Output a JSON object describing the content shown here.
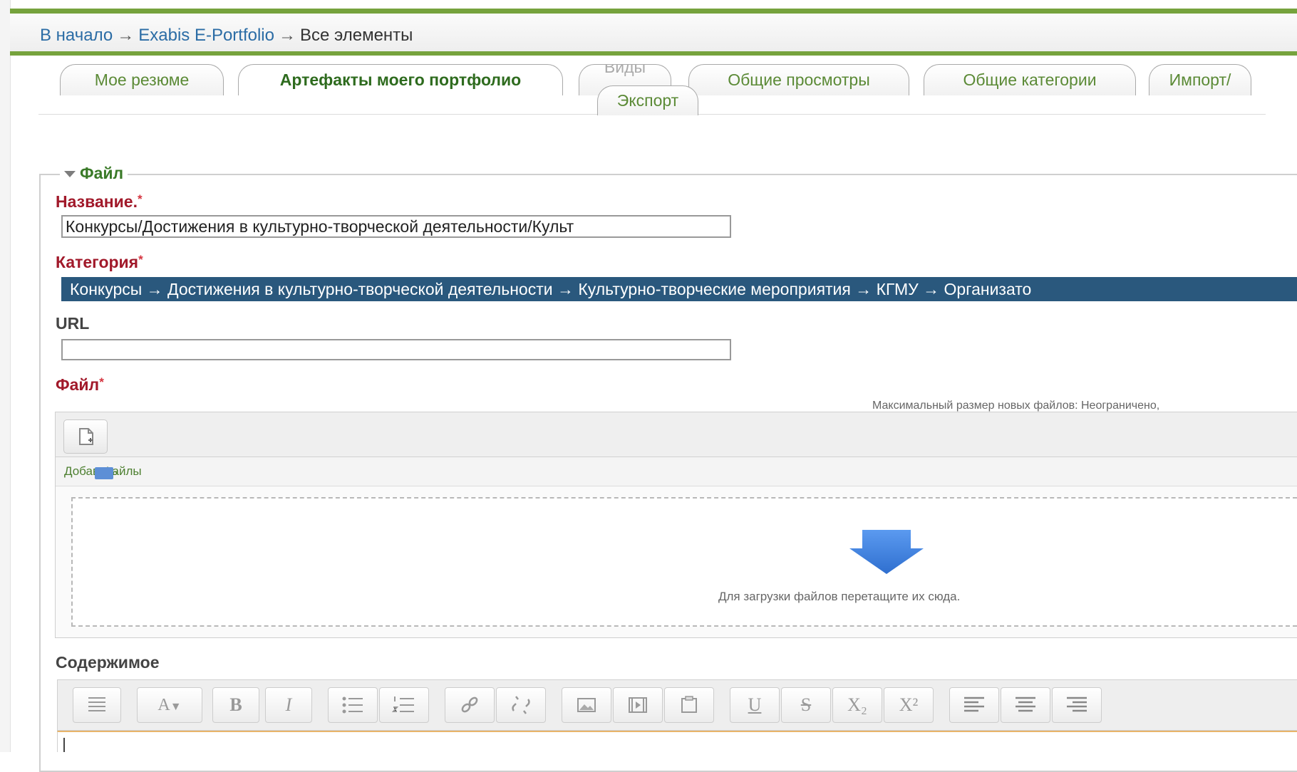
{
  "breadcrumb": {
    "home": "В начало",
    "separator": "→",
    "portfolio": "Exabis E-Portfolio",
    "current": "Все элементы"
  },
  "tabs": [
    {
      "label": "Мое резюме",
      "active": false
    },
    {
      "label": "Артефакты моего портфолио",
      "active": true
    },
    {
      "label": "Виды",
      "active": false
    },
    {
      "label": "Экспорт",
      "active": false
    },
    {
      "label": "Общие просмотры",
      "active": false
    },
    {
      "label": "Общие категории",
      "active": false
    },
    {
      "label": "Импорт/",
      "active": false
    }
  ],
  "form": {
    "legend": "Файл",
    "required_mark": "*",
    "title_label": "Название.",
    "title_value": "Конкурсы/Достижения в культурно-творческой деятельности/Культ",
    "category_label": "Категория",
    "category_value": "Конкурсы → Достижения в культурно-творческой деятельности → Культурно-творческие мероприятия → КГМУ → Организато",
    "url_label": "URL",
    "url_value": "",
    "file_label": "Файл",
    "max_size_text": "Максимальный размер новых файлов: Неограничено,",
    "path_text": "Добавить",
    "folder_text": "Файлы",
    "drop_text": "Для загрузки файлов перетащите их сюда.",
    "content_label": "Содержимое"
  },
  "editor_toolbar": {
    "icons": [
      "kitchen-sink-icon",
      "font-size-icon",
      "bold-icon",
      "italic-icon",
      "bullet-list-icon",
      "numbered-list-icon",
      "link-icon",
      "unlink-icon",
      "image-icon",
      "media-icon",
      "paste-icon",
      "underline-icon",
      "strikethrough-icon",
      "subscript-icon",
      "superscript-icon",
      "align-left-icon",
      "align-center-icon",
      "align-right-icon"
    ],
    "font_size_glyph": "A",
    "bold_glyph": "B",
    "italic_glyph": "I",
    "underline_glyph": "U",
    "strike_glyph": "S",
    "sub_glyph": "X₂",
    "sup_glyph": "X²"
  },
  "colors": {
    "accent_green": "#76a33d",
    "required_red": "#a1192a",
    "category_bg": "#2a587d"
  }
}
